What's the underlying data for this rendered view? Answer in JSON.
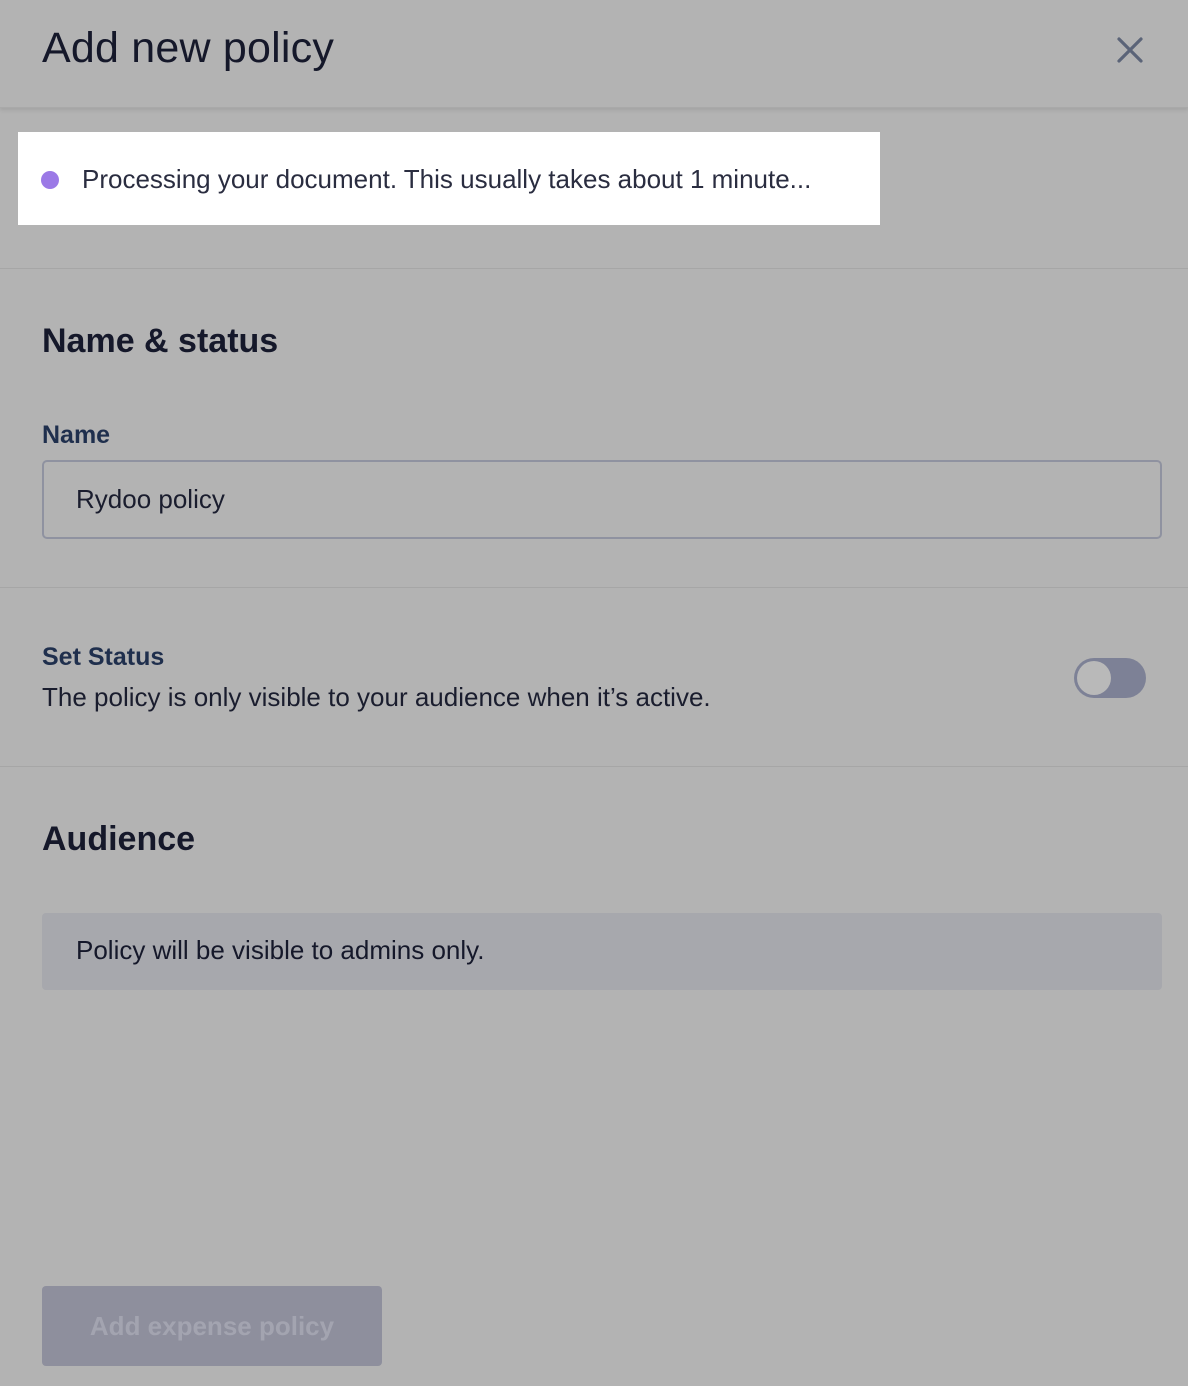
{
  "header": {
    "title": "Add new policy",
    "close_icon": "close-icon"
  },
  "notice": {
    "text": "Processing your document. This usually takes about 1 minute...",
    "dot_color": "#9b79e6"
  },
  "name_status": {
    "section_title": "Name & status",
    "name_label": "Name",
    "name_value": "Rydoo policy",
    "status_label": "Set Status",
    "status_description": "The policy is only visible to your audience when it’s active.",
    "status_active": false
  },
  "audience": {
    "section_title": "Audience",
    "message": "Policy will be visible to admins only."
  },
  "footer": {
    "submit_label": "Add expense policy"
  }
}
